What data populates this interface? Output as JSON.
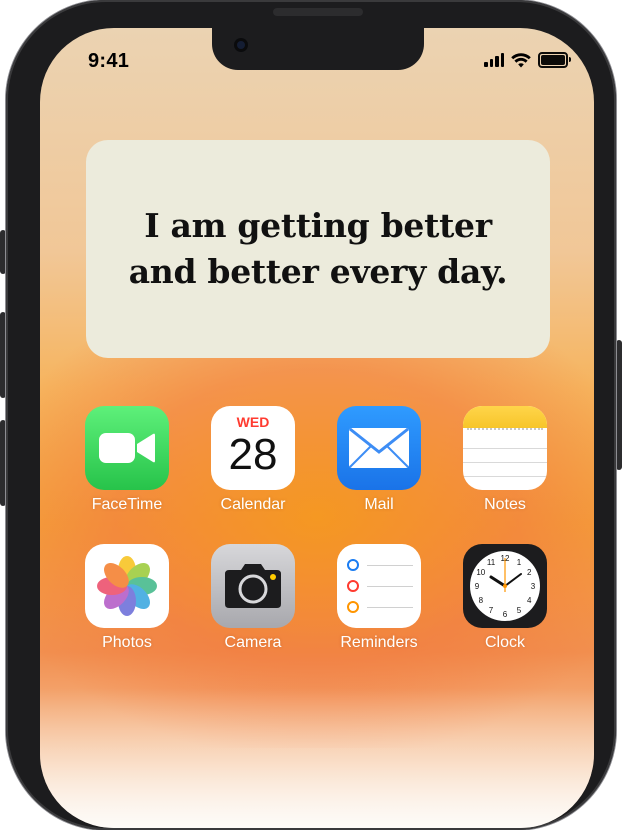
{
  "status_bar": {
    "time": "9:41"
  },
  "widget": {
    "text": "I am getting better and better every day."
  },
  "apps": [
    {
      "label": "FaceTime",
      "icon": "facetime-icon"
    },
    {
      "label": "Calendar",
      "icon": "calendar-icon",
      "day": "WED",
      "date": "28"
    },
    {
      "label": "Mail",
      "icon": "mail-icon"
    },
    {
      "label": "Notes",
      "icon": "notes-icon"
    },
    {
      "label": "Photos",
      "icon": "photos-icon"
    },
    {
      "label": "Camera",
      "icon": "camera-icon"
    },
    {
      "label": "Reminders",
      "icon": "reminders-icon"
    },
    {
      "label": "Clock",
      "icon": "clock-icon"
    }
  ],
  "clock": {
    "numerals": [
      "12",
      "1",
      "2",
      "3",
      "4",
      "5",
      "6",
      "7",
      "8",
      "9",
      "10",
      "11"
    ]
  },
  "colors": {
    "accent_red": "#ff3b30",
    "widget_bg": "#ecebdc",
    "facetime_green": "#27c34a",
    "mail_blue": "#1a73e8"
  }
}
